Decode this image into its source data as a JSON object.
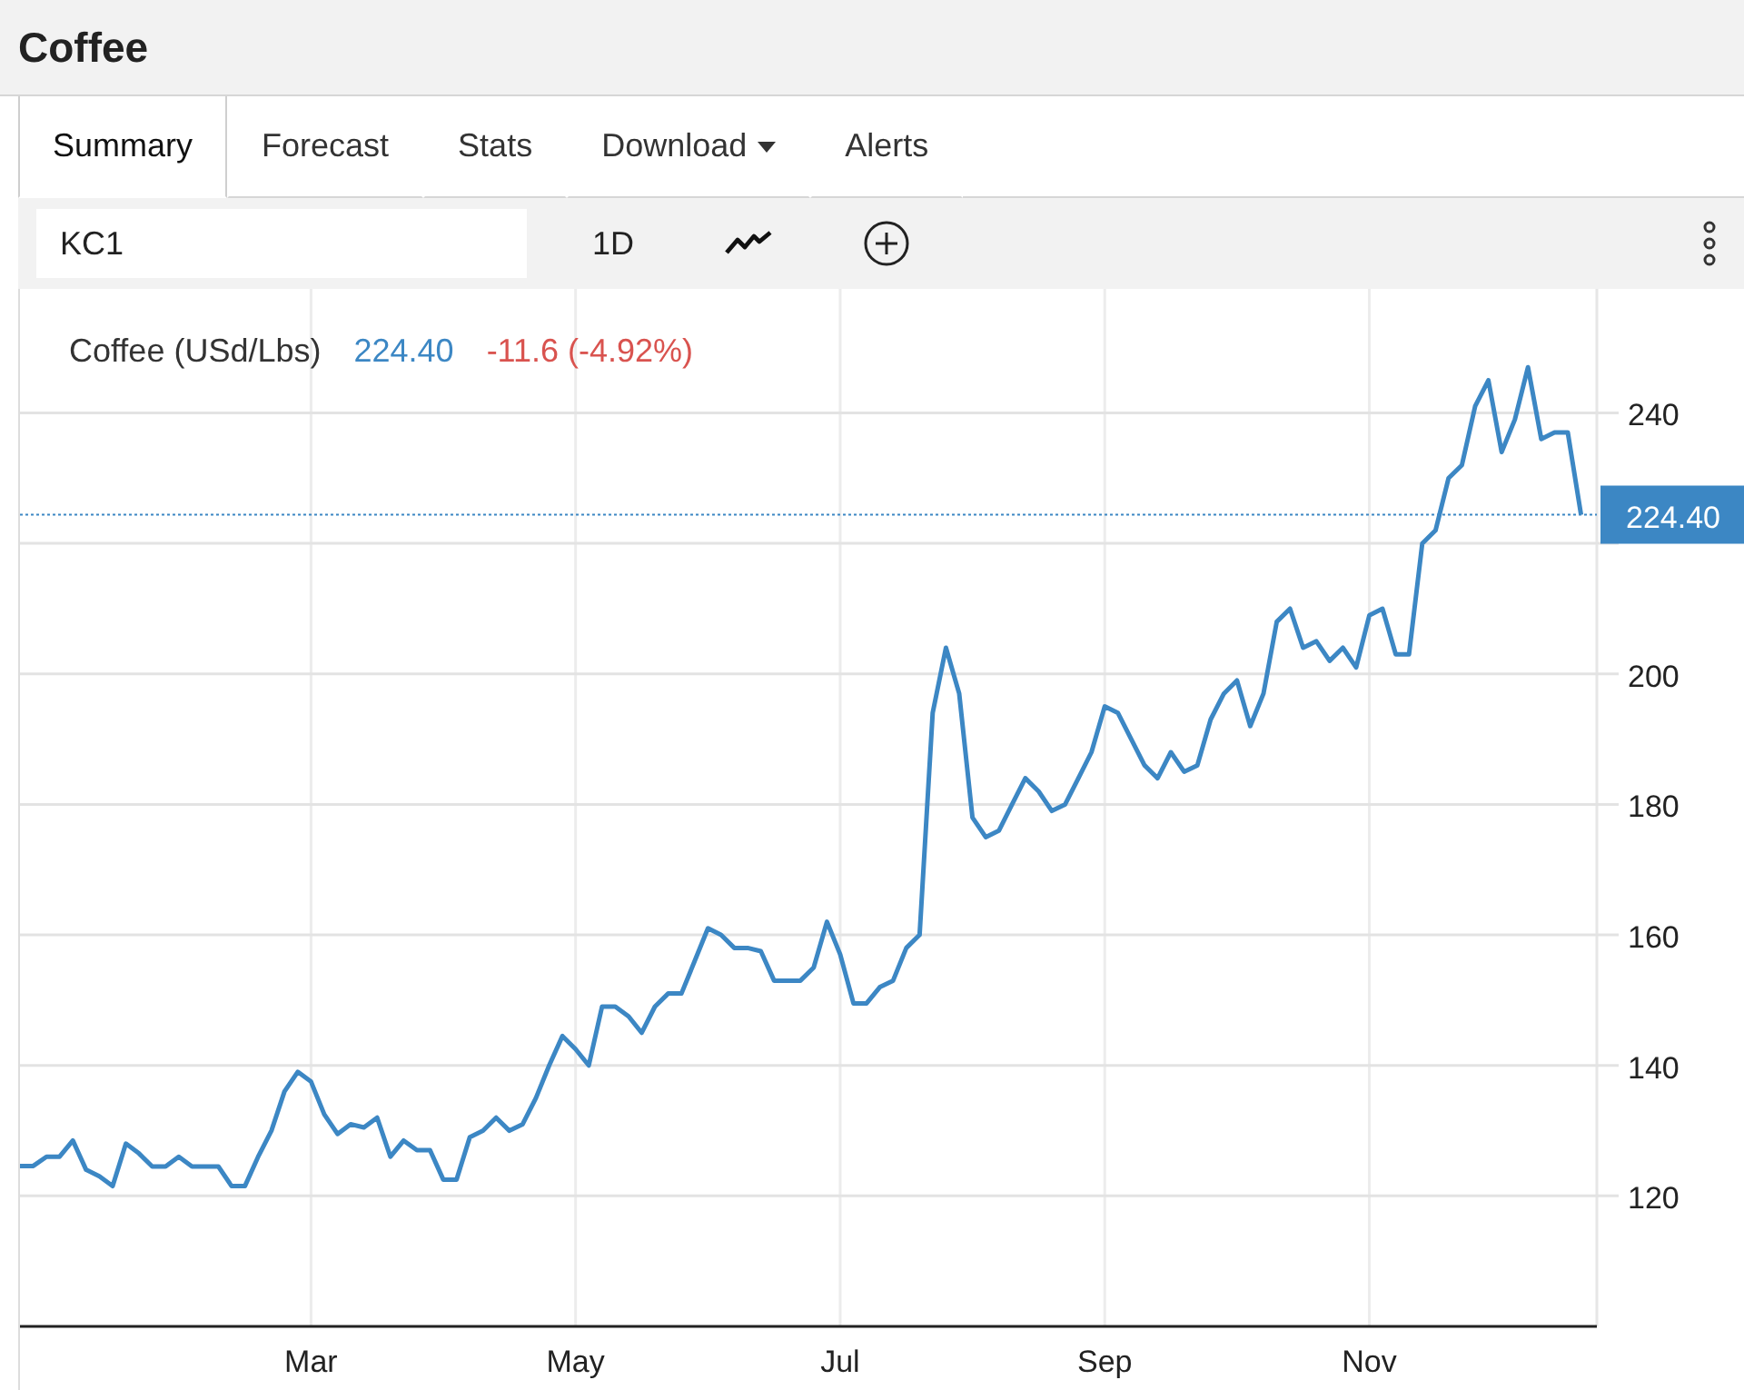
{
  "header": {
    "title": "Coffee"
  },
  "tabs": [
    {
      "label": "Summary",
      "selected": true,
      "kind": "plain"
    },
    {
      "label": "Forecast",
      "selected": false,
      "kind": "plain"
    },
    {
      "label": "Stats",
      "selected": false,
      "kind": "plain"
    },
    {
      "label": "Download",
      "selected": false,
      "kind": "dropdown"
    },
    {
      "label": "Alerts",
      "selected": false,
      "kind": "plain"
    }
  ],
  "toolbar": {
    "symbol": "KC1",
    "interval": "1D"
  },
  "chart": {
    "legend": {
      "name": "Coffee (USd/Lbs)",
      "price": "224.40",
      "change": "-11.6 (-4.92%)"
    },
    "last_price": "224.40",
    "chart_data": {
      "type": "line",
      "categories": [
        null,
        null,
        null,
        null,
        null,
        null,
        null,
        null,
        null,
        null,
        null,
        null,
        null,
        null,
        null,
        null,
        null,
        null,
        null,
        null,
        null,
        null,
        "Mar",
        null,
        null,
        null,
        null,
        null,
        null,
        null,
        null,
        null,
        null,
        null,
        null,
        null,
        null,
        null,
        null,
        null,
        null,
        null,
        "May",
        null,
        null,
        null,
        null,
        null,
        null,
        null,
        null,
        null,
        null,
        null,
        null,
        null,
        null,
        null,
        null,
        null,
        null,
        null,
        "Jul",
        null,
        null,
        null,
        null,
        null,
        null,
        null,
        null,
        null,
        null,
        null,
        null,
        null,
        null,
        null,
        null,
        null,
        null,
        null,
        "Sep",
        null,
        null,
        null,
        null,
        null,
        null,
        null,
        null,
        null,
        null,
        null,
        null,
        null,
        null,
        null,
        null,
        null,
        null,
        null,
        "Nov",
        null,
        null,
        null,
        null,
        null,
        null,
        null,
        null,
        null,
        null,
        null,
        null,
        null,
        null,
        null,
        null
      ],
      "series": [
        {
          "color": "#3c87c4",
          "values": [
            124.6,
            124.6,
            126,
            126,
            128.5,
            124,
            123,
            121.5,
            128,
            126.5,
            124.5,
            124.5,
            126,
            124.5,
            124.5,
            124.5,
            121.5,
            121.5,
            126,
            130,
            136,
            139,
            137.5,
            132.5,
            129.5,
            131,
            130.5,
            132,
            126,
            128.5,
            127,
            127,
            122.5,
            122.5,
            129,
            130,
            132,
            130,
            131,
            135,
            140,
            144.5,
            142.5,
            140,
            149,
            149,
            147.5,
            145,
            149,
            151,
            151,
            156,
            161,
            160,
            158,
            158,
            157.5,
            153,
            153,
            153,
            155,
            162,
            157,
            149.5,
            149.5,
            152,
            153,
            158,
            160,
            194,
            204,
            197,
            178,
            175,
            176,
            180,
            184,
            182,
            179,
            180,
            184,
            188,
            195,
            194,
            190,
            186,
            184,
            188,
            185,
            186,
            193,
            197,
            199,
            192,
            197,
            208,
            210,
            204,
            205,
            202,
            204,
            201,
            209,
            210,
            203,
            203,
            220,
            222,
            230,
            232,
            241,
            245,
            234,
            239,
            247,
            236,
            237,
            237,
            224.4
          ]
        }
      ],
      "ylim": [
        100,
        259
      ],
      "grid": true,
      "ref_lines": [
        {
          "axis": "y",
          "value": 224.4,
          "color": "#3c87c4"
        }
      ],
      "yticks": [
        120,
        140,
        160,
        180,
        200,
        240
      ]
    }
  }
}
